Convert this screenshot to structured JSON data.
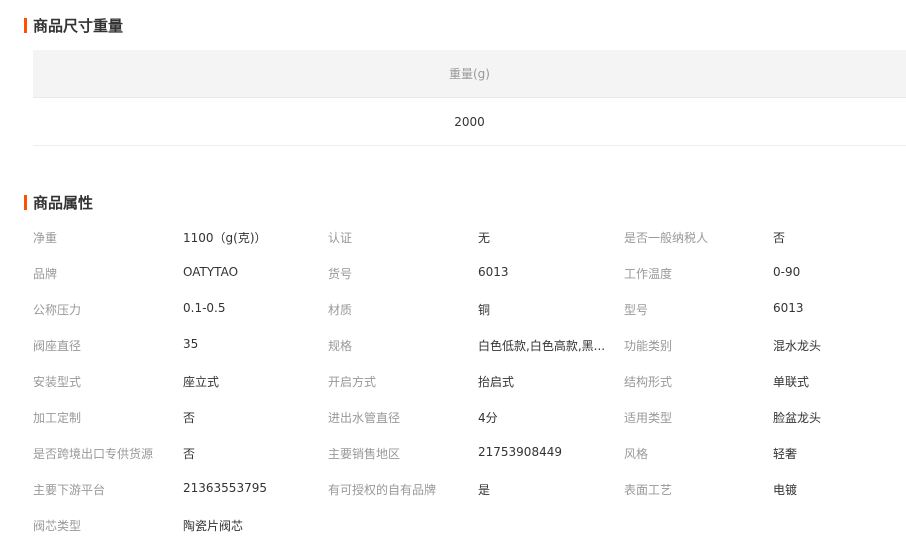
{
  "size_section": {
    "title": "商品尺寸重量",
    "header": "重量(g)",
    "value": "2000"
  },
  "attr_section": {
    "title": "商品属性",
    "rows": [
      [
        [
          "净重",
          "1100（g(克)）"
        ],
        [
          "认证",
          "无"
        ],
        [
          "是否一般纳税人",
          "否"
        ]
      ],
      [
        [
          "品牌",
          "OATYTAO"
        ],
        [
          "货号",
          "6013"
        ],
        [
          "工作温度",
          "0-90"
        ]
      ],
      [
        [
          "公称压力",
          "0.1-0.5"
        ],
        [
          "材质",
          "铜"
        ],
        [
          "型号",
          "6013"
        ]
      ],
      [
        [
          "阀座直径",
          "35"
        ],
        [
          "规格",
          "白色低款,白色高款,黑..."
        ],
        [
          "功能类别",
          "混水龙头"
        ]
      ],
      [
        [
          "安装型式",
          "座立式"
        ],
        [
          "开启方式",
          "抬启式"
        ],
        [
          "结构形式",
          "单联式"
        ]
      ],
      [
        [
          "加工定制",
          "否"
        ],
        [
          "进出水管直径",
          "4分"
        ],
        [
          "适用类型",
          "脸盆龙头"
        ]
      ],
      [
        [
          "是否跨境出口专供货源",
          "否"
        ],
        [
          "主要销售地区",
          "21753908449"
        ],
        [
          "风格",
          "轻奢"
        ]
      ],
      [
        [
          "主要下游平台",
          "21363553795"
        ],
        [
          "有可授权的自有品牌",
          "是"
        ],
        [
          "表面工艺",
          "电镀"
        ]
      ],
      [
        [
          "阀芯类型",
          "陶瓷片阀芯"
        ]
      ]
    ]
  },
  "colors": {
    "accent": "#ff5000",
    "label": "#999999",
    "value": "#333333",
    "header_bg": "#f4f4f4"
  }
}
